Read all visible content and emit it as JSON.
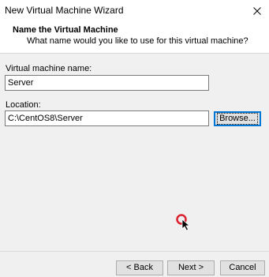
{
  "window": {
    "title": "New Virtual Machine Wizard"
  },
  "header": {
    "title": "Name the Virtual Machine",
    "subtitle": "What name would you like to use for this virtual machine?"
  },
  "form": {
    "vm_name_label": "Virtual machine name:",
    "vm_name_value": "Server",
    "location_label": "Location:",
    "location_value": "C:\\CentOS8\\Server",
    "browse_label": "Browse..."
  },
  "footer": {
    "back_label": "< Back",
    "next_label": "Next >",
    "cancel_label": "Cancel"
  },
  "icons": {
    "close": "close-icon",
    "cursor": "mouse-cursor-icon",
    "click": "click-indicator-icon"
  },
  "colors": {
    "focus_blue": "#0078d7",
    "click_ring": "#d9232e"
  }
}
